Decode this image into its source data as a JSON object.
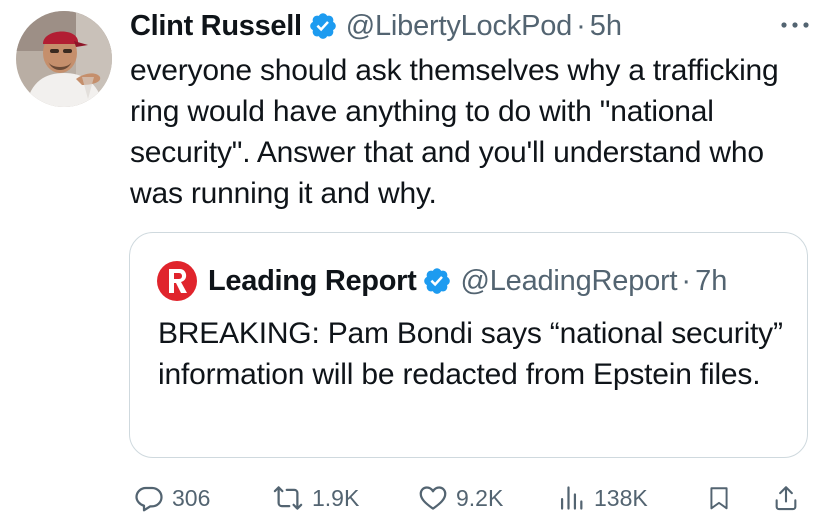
{
  "tweet": {
    "author": {
      "display_name": "Clint Russell",
      "handle": "@LibertyLockPod",
      "verified": true,
      "avatar_icon": "avatar-photo"
    },
    "separator": "·",
    "time": "5h",
    "text": "everyone should ask themselves why a trafficking ring would have anything to do with \"national security\". Answer that and you'll understand who was running it and why.",
    "more_icon": "more-icon"
  },
  "quoted_tweet": {
    "author": {
      "display_name": "Leading Report",
      "handle": "@LeadingReport",
      "verified": true,
      "avatar_icon": "leading-report-logo"
    },
    "separator": "·",
    "time": "7h",
    "text": "BREAKING:  Pam Bondi says “national security” information will be redacted from Epstein files."
  },
  "actions": {
    "replies": "306",
    "reposts": "1.9K",
    "likes": "9.2K",
    "views": "138K"
  },
  "colors": {
    "text": "#0f1419",
    "secondary": "#536471",
    "verified": "#1d9bf0",
    "border": "#cfd9de",
    "brand_red": "#e0242c"
  }
}
